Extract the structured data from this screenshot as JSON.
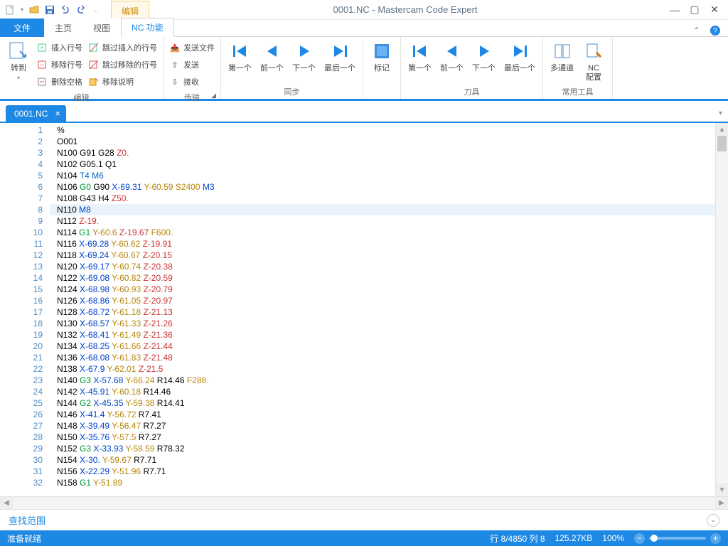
{
  "title": "0001.NC - Mastercam Code Expert",
  "qat_tab": "编辑",
  "menu": {
    "file": "文件",
    "home": "主页",
    "view": "视图",
    "nc": "NC 功能"
  },
  "ribbon": {
    "jump": {
      "label": "转到"
    },
    "edit_group": "编辑",
    "insert_line": "插入行号",
    "remove_line": "移除行号",
    "remove_blank": "删除空格",
    "skip_insert": "跳过插入的行号",
    "skip_remove": "跳过移除的行号",
    "remove_note": "移除说明",
    "transfer_group": "传输",
    "send_file": "发送文件",
    "send": "发送",
    "receive": "接收",
    "sync_group": "同步",
    "first": "第一个",
    "prev": "前一个",
    "next": "下一个",
    "last": "最后一个",
    "mark": "标记",
    "tool_group": "刀具",
    "common_group": "常用工具",
    "multi": "多通道",
    "nc_cfg1": "NC",
    "nc_cfg2": "配置"
  },
  "doc_tab": "0001.NC",
  "find_label": "查找范围",
  "status": {
    "ready": "准备就绪",
    "pos": "行 8/4850  列 8",
    "size": "125.27KB",
    "zoom": "100%"
  },
  "code": [
    [
      {
        "c": "pct",
        "t": "%"
      }
    ],
    [
      {
        "c": "o",
        "t": "O001"
      }
    ],
    [
      {
        "c": "n",
        "t": "N100 "
      },
      {
        "c": "h",
        "t": "G91 G28 "
      },
      {
        "c": "z",
        "t": "Z0."
      }
    ],
    [
      {
        "c": "n",
        "t": "N102 "
      },
      {
        "c": "h",
        "t": "G05.1 Q1"
      }
    ],
    [
      {
        "c": "n",
        "t": "N104 "
      },
      {
        "c": "t",
        "t": "T4 M6"
      }
    ],
    [
      {
        "c": "n",
        "t": "N106 "
      },
      {
        "c": "g",
        "t": "G0 "
      },
      {
        "c": "h",
        "t": "G90 "
      },
      {
        "c": "x",
        "t": "X-69.31 "
      },
      {
        "c": "y",
        "t": "Y-60.59 "
      },
      {
        "c": "s",
        "t": "S2400 "
      },
      {
        "c": "m",
        "t": "M3"
      }
    ],
    [
      {
        "c": "n",
        "t": "N108 "
      },
      {
        "c": "h",
        "t": "G43 H4 "
      },
      {
        "c": "z",
        "t": "Z50."
      }
    ],
    [
      {
        "c": "n",
        "t": "N110 "
      },
      {
        "c": "m",
        "t": "M8"
      }
    ],
    [
      {
        "c": "n",
        "t": "N112 "
      },
      {
        "c": "z",
        "t": "Z-19."
      }
    ],
    [
      {
        "c": "n",
        "t": "N114 "
      },
      {
        "c": "g",
        "t": "G1 "
      },
      {
        "c": "y",
        "t": "Y-60.6 "
      },
      {
        "c": "z",
        "t": "Z-19.67 "
      },
      {
        "c": "f",
        "t": "F600."
      }
    ],
    [
      {
        "c": "n",
        "t": "N116 "
      },
      {
        "c": "x",
        "t": "X-69.28 "
      },
      {
        "c": "y",
        "t": "Y-60.62 "
      },
      {
        "c": "z",
        "t": "Z-19.91"
      }
    ],
    [
      {
        "c": "n",
        "t": "N118 "
      },
      {
        "c": "x",
        "t": "X-69.24 "
      },
      {
        "c": "y",
        "t": "Y-60.67 "
      },
      {
        "c": "z",
        "t": "Z-20.15"
      }
    ],
    [
      {
        "c": "n",
        "t": "N120 "
      },
      {
        "c": "x",
        "t": "X-69.17 "
      },
      {
        "c": "y",
        "t": "Y-60.74 "
      },
      {
        "c": "z",
        "t": "Z-20.38"
      }
    ],
    [
      {
        "c": "n",
        "t": "N122 "
      },
      {
        "c": "x",
        "t": "X-69.08 "
      },
      {
        "c": "y",
        "t": "Y-60.82 "
      },
      {
        "c": "z",
        "t": "Z-20.59"
      }
    ],
    [
      {
        "c": "n",
        "t": "N124 "
      },
      {
        "c": "x",
        "t": "X-68.98 "
      },
      {
        "c": "y",
        "t": "Y-60.93 "
      },
      {
        "c": "z",
        "t": "Z-20.79"
      }
    ],
    [
      {
        "c": "n",
        "t": "N126 "
      },
      {
        "c": "x",
        "t": "X-68.86 "
      },
      {
        "c": "y",
        "t": "Y-61.05 "
      },
      {
        "c": "z",
        "t": "Z-20.97"
      }
    ],
    [
      {
        "c": "n",
        "t": "N128 "
      },
      {
        "c": "x",
        "t": "X-68.72 "
      },
      {
        "c": "y",
        "t": "Y-61.18 "
      },
      {
        "c": "z",
        "t": "Z-21.13"
      }
    ],
    [
      {
        "c": "n",
        "t": "N130 "
      },
      {
        "c": "x",
        "t": "X-68.57 "
      },
      {
        "c": "y",
        "t": "Y-61.33 "
      },
      {
        "c": "z",
        "t": "Z-21.26"
      }
    ],
    [
      {
        "c": "n",
        "t": "N132 "
      },
      {
        "c": "x",
        "t": "X-68.41 "
      },
      {
        "c": "y",
        "t": "Y-61.49 "
      },
      {
        "c": "z",
        "t": "Z-21.36"
      }
    ],
    [
      {
        "c": "n",
        "t": "N134 "
      },
      {
        "c": "x",
        "t": "X-68.25 "
      },
      {
        "c": "y",
        "t": "Y-61.66 "
      },
      {
        "c": "z",
        "t": "Z-21.44"
      }
    ],
    [
      {
        "c": "n",
        "t": "N136 "
      },
      {
        "c": "x",
        "t": "X-68.08 "
      },
      {
        "c": "y",
        "t": "Y-61.83 "
      },
      {
        "c": "z",
        "t": "Z-21.48"
      }
    ],
    [
      {
        "c": "n",
        "t": "N138 "
      },
      {
        "c": "x",
        "t": "X-67.9 "
      },
      {
        "c": "y",
        "t": "Y-62.01 "
      },
      {
        "c": "z",
        "t": "Z-21.5"
      }
    ],
    [
      {
        "c": "n",
        "t": "N140 "
      },
      {
        "c": "g",
        "t": "G3 "
      },
      {
        "c": "x",
        "t": "X-57.68 "
      },
      {
        "c": "y",
        "t": "Y-66.24 "
      },
      {
        "c": "r",
        "t": "R14.46 "
      },
      {
        "c": "f",
        "t": "F288."
      }
    ],
    [
      {
        "c": "n",
        "t": "N142 "
      },
      {
        "c": "x",
        "t": "X-45.91 "
      },
      {
        "c": "y",
        "t": "Y-60.18 "
      },
      {
        "c": "r",
        "t": "R14.46"
      }
    ],
    [
      {
        "c": "n",
        "t": "N144 "
      },
      {
        "c": "g",
        "t": "G2 "
      },
      {
        "c": "x",
        "t": "X-45.35 "
      },
      {
        "c": "y",
        "t": "Y-59.38 "
      },
      {
        "c": "r",
        "t": "R14.41"
      }
    ],
    [
      {
        "c": "n",
        "t": "N146 "
      },
      {
        "c": "x",
        "t": "X-41.4 "
      },
      {
        "c": "y",
        "t": "Y-56.72 "
      },
      {
        "c": "r",
        "t": "R7.41"
      }
    ],
    [
      {
        "c": "n",
        "t": "N148 "
      },
      {
        "c": "x",
        "t": "X-39.49 "
      },
      {
        "c": "y",
        "t": "Y-56.47 "
      },
      {
        "c": "r",
        "t": "R7.27"
      }
    ],
    [
      {
        "c": "n",
        "t": "N150 "
      },
      {
        "c": "x",
        "t": "X-35.76 "
      },
      {
        "c": "y",
        "t": "Y-57.5 "
      },
      {
        "c": "r",
        "t": "R7.27"
      }
    ],
    [
      {
        "c": "n",
        "t": "N152 "
      },
      {
        "c": "g",
        "t": "G3 "
      },
      {
        "c": "x",
        "t": "X-33.93 "
      },
      {
        "c": "y",
        "t": "Y-58.59 "
      },
      {
        "c": "r",
        "t": "R78.32"
      }
    ],
    [
      {
        "c": "n",
        "t": "N154 "
      },
      {
        "c": "x",
        "t": "X-30. "
      },
      {
        "c": "y",
        "t": "Y-59.67 "
      },
      {
        "c": "r",
        "t": "R7.71"
      }
    ],
    [
      {
        "c": "n",
        "t": "N156 "
      },
      {
        "c": "x",
        "t": "X-22.29 "
      },
      {
        "c": "y",
        "t": "Y-51.96 "
      },
      {
        "c": "r",
        "t": "R7.71"
      }
    ],
    [
      {
        "c": "n",
        "t": "N158 "
      },
      {
        "c": "g",
        "t": "G1 "
      },
      {
        "c": "y",
        "t": "Y-51.89"
      }
    ]
  ],
  "highlight_line": 8
}
